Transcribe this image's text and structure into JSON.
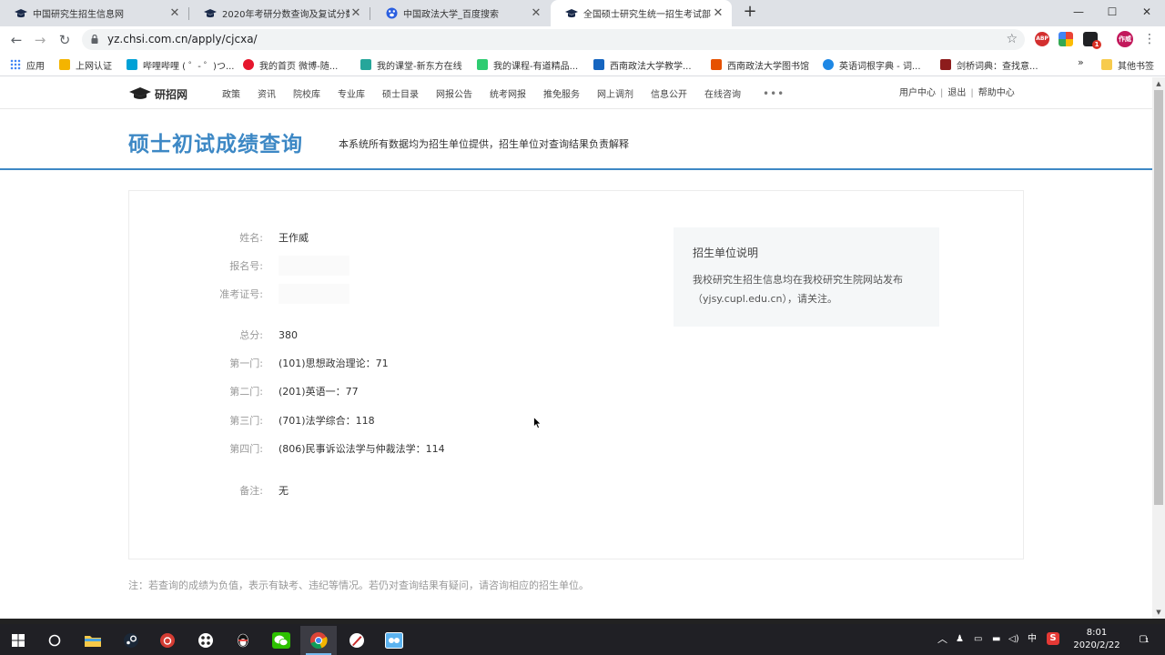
{
  "browser": {
    "tabs": [
      {
        "title": "中国研究生招生信息网",
        "close": "✕"
      },
      {
        "title": "2020年考研分数查询及复试分数",
        "close": "✕"
      },
      {
        "title": "中国政法大学_百度搜索",
        "close": "✕"
      },
      {
        "title": "全国硕士研究生统一招生考试部",
        "close": "✕"
      }
    ],
    "new_tab": "+",
    "window_controls": {
      "minimize": "—",
      "maximize": "☐",
      "close": "✕"
    },
    "nav": {
      "back": "←",
      "forward": "→",
      "reload": "↻"
    },
    "url": "yz.chsi.com.cn/apply/cjcxa/",
    "star": "☆",
    "extensions": [
      {
        "label": "ABP",
        "color": "#d32f2f"
      },
      {
        "label": "",
        "color": "#43a047"
      },
      {
        "label": "1",
        "color": "#202124"
      },
      {
        "label": "作威",
        "color": "#c2185b"
      }
    ],
    "menu": "⋮",
    "bookmarks": [
      {
        "label": "应用",
        "color": "#4285f4"
      },
      {
        "label": "上网认证",
        "color": "#f4b400"
      },
      {
        "label": "哔哩哔哩 ( ゜- ゜)つ...",
        "color": "#00a1d6"
      },
      {
        "label": "我的首页 微博-随...",
        "color": "#e6162d"
      },
      {
        "label": "我的课堂-新东方在线",
        "color": "#26a69a"
      },
      {
        "label": "我的课程-有道精品...",
        "color": "#2ecc71"
      },
      {
        "label": "西南政法大学教学...",
        "color": "#1565c0"
      },
      {
        "label": "西南政法大学图书馆",
        "color": "#e65100"
      },
      {
        "label": "英语词根字典 - 词...",
        "color": "#1e88e5"
      },
      {
        "label": "剑桥词典：查找意...",
        "color": "#8d1c1c"
      }
    ],
    "bookmarks_more": "»",
    "other_bookmarks": "其他书签"
  },
  "site": {
    "logo": "研招网",
    "nav": [
      "政策",
      "资讯",
      "院校库",
      "专业库",
      "硕士目录",
      "网报公告",
      "统考网报",
      "推免服务",
      "网上调剂",
      "信息公开",
      "在线咨询"
    ],
    "nav_more": "•••",
    "user_links": [
      "用户中心",
      "退出",
      "帮助中心"
    ],
    "user_sep": "|",
    "page_title": "硕士初试成绩查询",
    "page_subtitle": "本系统所有数据均为招生单位提供，招生单位对查询结果负责解释"
  },
  "result": {
    "name_label": "姓名:",
    "name_value": "王作威",
    "regno_label": "报名号:",
    "examno_label": "准考证号:",
    "total_label": "总分:",
    "total_value": "380",
    "subjects": [
      {
        "label": "第一门:",
        "value": "(101)思想政治理论：71"
      },
      {
        "label": "第二门:",
        "value": "(201)英语一：77"
      },
      {
        "label": "第三门:",
        "value": "(701)法学综合：118"
      },
      {
        "label": "第四门:",
        "value": "(806)民事诉讼法学与仲裁法学：114"
      }
    ],
    "remark_label": "备注:",
    "remark_value": "无"
  },
  "notice": {
    "title": "招生单位说明",
    "body": "我校研究生招生信息均在我校研究生院网站发布（yjsy.cupl.edu.cn），请关注。"
  },
  "footnote": "注：若查询的成绩为负值，表示有缺考、违纪等情况。若仍对查询结果有疑问，请咨询相应的招生单位。",
  "taskbar": {
    "tray_ime": "中",
    "tray_sogou": "S",
    "time": "8:01",
    "date": "2020/2/22",
    "notifications": "1"
  }
}
